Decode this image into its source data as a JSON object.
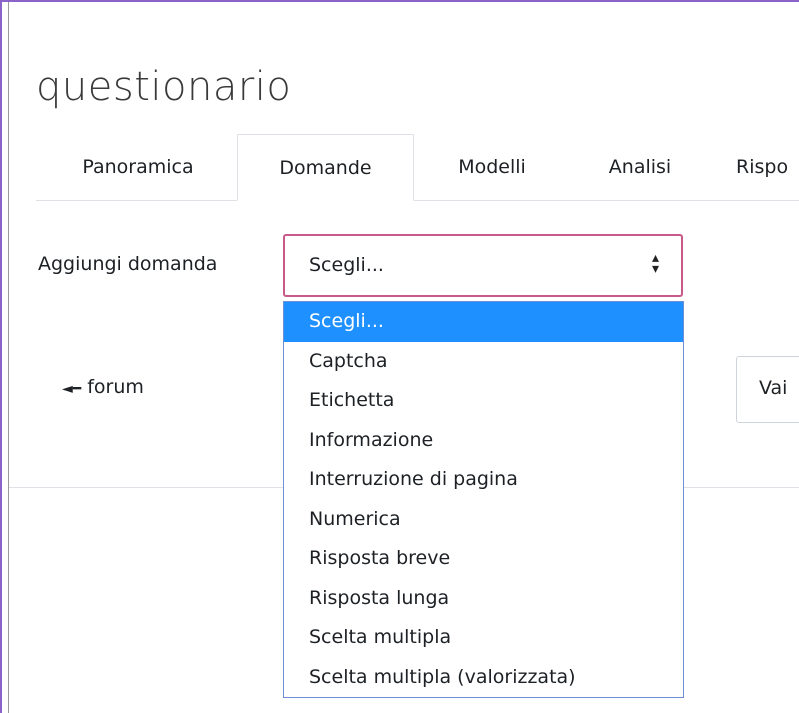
{
  "page": {
    "title": "questionario"
  },
  "tabs": [
    {
      "label": "Panoramica",
      "active": false
    },
    {
      "label": "Domande",
      "active": true
    },
    {
      "label": "Modelli",
      "active": false
    },
    {
      "label": "Analisi",
      "active": false
    },
    {
      "label": "Rispo",
      "active": false
    }
  ],
  "add_question": {
    "label": "Aggiungi domanda",
    "selected": "Scegli...",
    "options": [
      "Scegli...",
      "Captcha",
      "Etichetta",
      "Informazione",
      "Interruzione di pagina",
      "Numerica",
      "Risposta breve",
      "Risposta lunga",
      "Scelta multipla",
      "Scelta multipla (valorizzata)"
    ],
    "highlighted_index": 0
  },
  "nav": {
    "prev_link": "forum",
    "prev_icon": "arrow-left-icon",
    "jump_label": "Vai"
  },
  "colors": {
    "select_border": "#c85a8a",
    "option_highlight": "#1e90ff",
    "frame_accent": "#8a63c9"
  }
}
